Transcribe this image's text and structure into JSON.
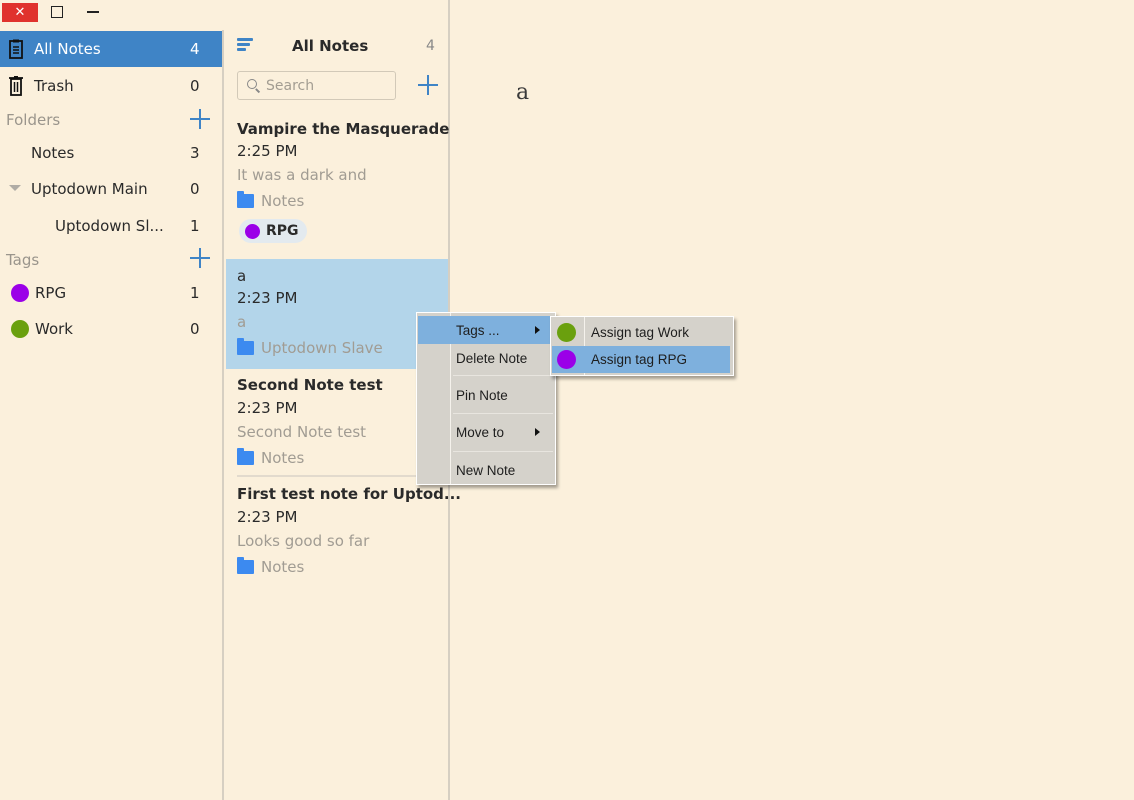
{
  "window": {
    "close_label": "✕",
    "maximize_icon": "maximize-icon",
    "minimize_icon": "minimize-icon"
  },
  "sidebar": {
    "all_notes": {
      "label": "All Notes",
      "count": "4",
      "icon": "notebook-icon",
      "selected": true
    },
    "trash": {
      "label": "Trash",
      "count": "0",
      "icon": "trash-icon"
    },
    "folders_header": "Folders",
    "folders": [
      {
        "label": "Notes",
        "count": "3"
      },
      {
        "label": "Uptodown Main",
        "count": "0",
        "expanded": true
      },
      {
        "label": "Uptodown Sl...",
        "count": "1",
        "child": true
      }
    ],
    "tags_header": "Tags",
    "tags": [
      {
        "label": "RPG",
        "count": "1",
        "color": "#9b00e8"
      },
      {
        "label": "Work",
        "count": "0",
        "color": "#6aa00e"
      }
    ]
  },
  "note_list": {
    "title": "All Notes",
    "count": "4",
    "search_placeholder": "Search",
    "notes": [
      {
        "title": "Vampire the Masquerade",
        "time": "2:25 PM",
        "preview": "It was a dark and",
        "folder": "Notes",
        "tag": "RPG",
        "tag_color": "#9b00e8"
      },
      {
        "title": "a",
        "time": "2:23 PM",
        "preview": "a",
        "folder": "Uptodown Slave",
        "selected": true
      },
      {
        "title": "Second Note test",
        "time": "2:23 PM",
        "preview": "Second Note test",
        "folder": "Notes"
      },
      {
        "title": "First test note for Uptod...",
        "time": "2:23 PM",
        "preview": "Looks good so far",
        "folder": "Notes"
      }
    ]
  },
  "editor": {
    "content": "a"
  },
  "context_menu": {
    "items": [
      {
        "label": "Tags ...",
        "submenu": true,
        "highlighted": true
      },
      {
        "label": "Delete Note"
      },
      {
        "label": "Pin Note"
      },
      {
        "label": "Move to",
        "submenu": true
      },
      {
        "label": "New Note"
      }
    ],
    "tags_submenu": [
      {
        "label": "Assign tag Work",
        "color": "#6aa00e"
      },
      {
        "label": "Assign tag RPG",
        "color": "#9b00e8",
        "highlighted": true
      }
    ]
  },
  "colors": {
    "background": "#fbf0dc",
    "accent": "#3f84c6",
    "selected_note": "#b3d5ea",
    "menu_highlight": "#7eb0dd",
    "close_button": "#e0322d"
  }
}
